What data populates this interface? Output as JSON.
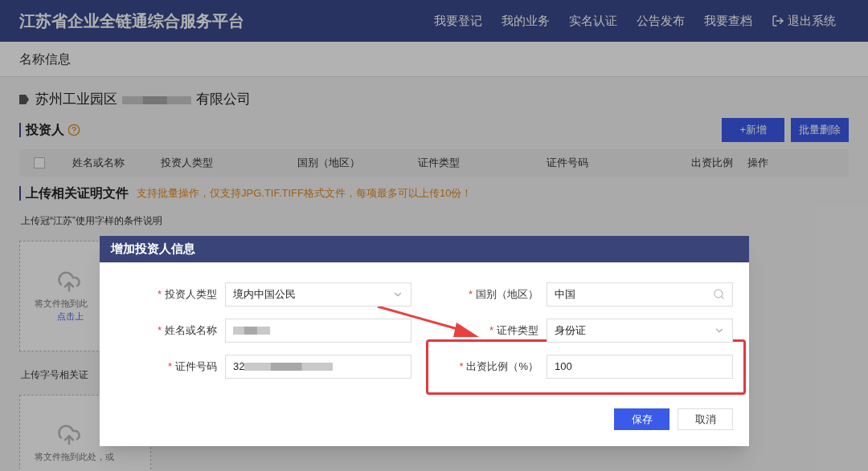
{
  "header": {
    "title": "江苏省企业全链通综合服务平台",
    "nav": [
      {
        "label": "我要登记",
        "kind": "link"
      },
      {
        "label": "我的业务",
        "kind": "link"
      },
      {
        "label": "实名认证",
        "kind": "link"
      },
      {
        "label": "公告发布",
        "kind": "link"
      },
      {
        "label": "我要查档",
        "kind": "link"
      },
      {
        "label": "退出系统",
        "kind": "logout"
      }
    ]
  },
  "breadcrumb": "名称信息",
  "company": {
    "prefix": "苏州工业园区",
    "suffix": "有限公司"
  },
  "investors": {
    "title": "投资人",
    "buttons": [
      "+新增",
      "批量删除"
    ],
    "select_all": {
      "checked": false
    },
    "columns": [
      "姓名或名称",
      "投资人类型",
      "国别（地区）",
      "证件类型",
      "证件号码",
      "出资比例",
      "操作"
    ]
  },
  "upload": {
    "title": "上传相关证明文件",
    "notice": "支持批量操作，仅支持JPG.TIF.TIFF格式文件，每项最多可以上传10份！",
    "sections": [
      {
        "label": "上传冠“江苏”使用字样的条件说明",
        "drop_text": "将文件拖到此",
        "link_text": "点击上"
      },
      {
        "label": "上传字号相关证",
        "drop_text": "将文件拖到此处，或"
      }
    ]
  },
  "dialog": {
    "title": "增加投资人信息",
    "fields": [
      {
        "label": "投资人类型",
        "mark": "*",
        "value": "境内中国公民",
        "kind": "select",
        "redacted": false,
        "highlighted": false
      },
      {
        "label": "国别（地区）",
        "mark": "*",
        "value": "中国",
        "kind": "search",
        "redacted": false,
        "highlighted": false
      },
      {
        "label": "姓名或名称",
        "mark": "*",
        "kind": "text",
        "redacted": true,
        "highlighted": false
      },
      {
        "label": "证件类型",
        "mark": "*",
        "value": "身份证",
        "kind": "select",
        "redacted": false,
        "highlighted": false
      },
      {
        "label": "证件号码",
        "mark": "*",
        "value": "32",
        "kind": "text",
        "redacted": true,
        "highlighted": false
      },
      {
        "label": "出资比例（%）",
        "mark": "*",
        "value": "100",
        "kind": "text",
        "redacted": false,
        "highlighted": true
      }
    ],
    "buttons": [
      {
        "label": "保存",
        "kind": "primary"
      },
      {
        "label": "取消",
        "kind": "secondary"
      }
    ]
  }
}
